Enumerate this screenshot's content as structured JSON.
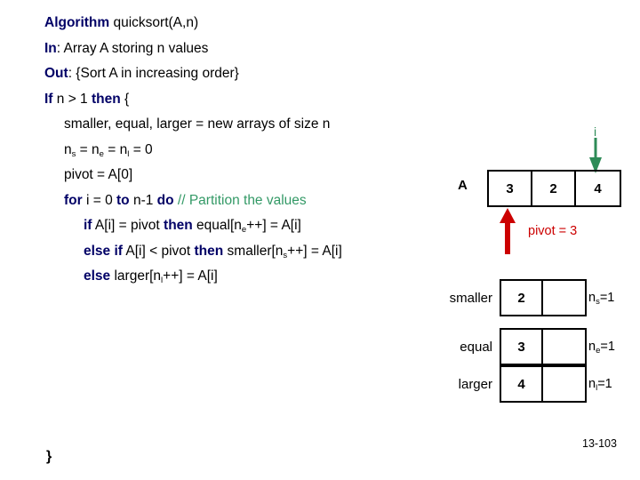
{
  "pseudocode": {
    "lines": [
      {
        "indent": 0,
        "parts": [
          {
            "style": "kw",
            "text": "Algorithm"
          },
          {
            "style": "plain",
            "text": " quicksort(A,n)"
          }
        ]
      },
      {
        "indent": 0,
        "parts": [
          {
            "style": "kw",
            "text": "In"
          },
          {
            "style": "plain",
            "text": ": Array A storing n values"
          }
        ]
      },
      {
        "indent": 0,
        "parts": [
          {
            "style": "kw",
            "text": "Out"
          },
          {
            "style": "plain",
            "text": ": {Sort A in increasing order}"
          }
        ]
      },
      {
        "indent": 0,
        "parts": [
          {
            "style": "kw",
            "text": "If"
          },
          {
            "style": "plain",
            "text": " n > 1 "
          },
          {
            "style": "kw",
            "text": "then"
          },
          {
            "style": "plain",
            "text": " {"
          }
        ]
      },
      {
        "indent": 1,
        "parts": [
          {
            "style": "plain",
            "text": "smaller, equal, larger = new arrays of size n"
          }
        ]
      },
      {
        "indent": 1,
        "parts": [
          {
            "style": "plain",
            "text": "n"
          },
          {
            "style": "sub",
            "text": "s"
          },
          {
            "style": "plain",
            "text": " = n"
          },
          {
            "style": "sub",
            "text": "e"
          },
          {
            "style": "plain",
            "text": " = n"
          },
          {
            "style": "sub",
            "text": "l"
          },
          {
            "style": "plain",
            "text": " = 0"
          }
        ]
      },
      {
        "indent": 1,
        "parts": [
          {
            "style": "plain",
            "text": "pivot = A[0]"
          }
        ]
      },
      {
        "indent": 1,
        "parts": [
          {
            "style": "kw",
            "text": "for"
          },
          {
            "style": "plain",
            "text": " i = 0 "
          },
          {
            "style": "kw",
            "text": "to"
          },
          {
            "style": "plain",
            "text": " n-1 "
          },
          {
            "style": "kw",
            "text": "do"
          },
          {
            "style": "plain",
            "text": "  "
          },
          {
            "style": "comment",
            "text": "// Partition the values"
          }
        ]
      },
      {
        "indent": 2,
        "parts": [
          {
            "style": "kw",
            "text": "if"
          },
          {
            "style": "plain",
            "text": " A[i] = pivot "
          },
          {
            "style": "kw",
            "text": "then"
          },
          {
            "style": "plain",
            "text": " equal[n"
          },
          {
            "style": "sub",
            "text": "e"
          },
          {
            "style": "plain",
            "text": "++] = A[i]"
          }
        ]
      },
      {
        "indent": 2,
        "parts": [
          {
            "style": "kw",
            "text": "else if"
          },
          {
            "style": "plain",
            "text": " A[i] < pivot "
          },
          {
            "style": "kw",
            "text": "then"
          },
          {
            "style": "plain",
            "text": " smaller[n"
          },
          {
            "style": "sub",
            "text": "s"
          },
          {
            "style": "plain",
            "text": "++] = A[i]"
          }
        ]
      },
      {
        "indent": 2,
        "parts": [
          {
            "style": "kw",
            "text": "else"
          },
          {
            "style": "plain",
            "text": " larger[n"
          },
          {
            "style": "sub",
            "text": "l"
          },
          {
            "style": "plain",
            "text": "++] = A[i]"
          }
        ]
      }
    ],
    "closing_brace": "}"
  },
  "diagram": {
    "array_a": {
      "label": "A",
      "cells": [
        "3",
        "2",
        "4"
      ]
    },
    "index_marker": {
      "label": "i",
      "color": "#2e8b57",
      "points_to_cell": 2
    },
    "pivot_marker": {
      "label": "pivot = 3",
      "color": "#cc0000",
      "points_to_cell": 0
    },
    "buckets": [
      {
        "label": "smaller",
        "cells": [
          "2",
          ""
        ],
        "count_prefix": "n",
        "count_sub": "s",
        "count_suffix": "=1"
      },
      {
        "label": "equal",
        "cells": [
          "3",
          ""
        ],
        "count_prefix": "n",
        "count_sub": "e",
        "count_suffix": "=1"
      },
      {
        "label": "larger",
        "cells": [
          "4",
          ""
        ],
        "count_prefix": "n",
        "count_sub": "l",
        "count_suffix": "=1"
      }
    ]
  },
  "footer": {
    "page_number": "13-103"
  },
  "colors": {
    "keyword": "#000066",
    "comment": "#339966",
    "pivot": "#cc0000",
    "index": "#2e8b57",
    "text": "#000000",
    "background": "#ffffff"
  }
}
